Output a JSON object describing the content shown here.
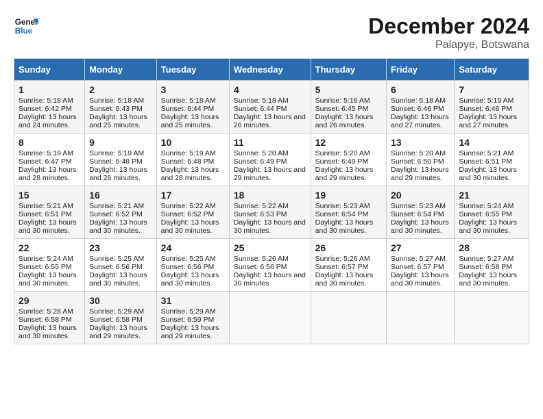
{
  "header": {
    "logo_line1": "General",
    "logo_line2": "Blue",
    "title": "December 2024",
    "subtitle": "Palapye, Botswana"
  },
  "columns": [
    "Sunday",
    "Monday",
    "Tuesday",
    "Wednesday",
    "Thursday",
    "Friday",
    "Saturday"
  ],
  "rows": [
    [
      {
        "day": "1",
        "rise": "Sunrise: 5:18 AM",
        "set": "Sunset: 6:42 PM",
        "daylight": "Daylight: 13 hours and 24 minutes."
      },
      {
        "day": "2",
        "rise": "Sunrise: 5:18 AM",
        "set": "Sunset: 6:43 PM",
        "daylight": "Daylight: 13 hours and 25 minutes."
      },
      {
        "day": "3",
        "rise": "Sunrise: 5:18 AM",
        "set": "Sunset: 6:44 PM",
        "daylight": "Daylight: 13 hours and 25 minutes."
      },
      {
        "day": "4",
        "rise": "Sunrise: 5:18 AM",
        "set": "Sunset: 6:44 PM",
        "daylight": "Daylight: 13 hours and 26 minutes."
      },
      {
        "day": "5",
        "rise": "Sunrise: 5:18 AM",
        "set": "Sunset: 6:45 PM",
        "daylight": "Daylight: 13 hours and 26 minutes."
      },
      {
        "day": "6",
        "rise": "Sunrise: 5:18 AM",
        "set": "Sunset: 6:46 PM",
        "daylight": "Daylight: 13 hours and 27 minutes."
      },
      {
        "day": "7",
        "rise": "Sunrise: 5:19 AM",
        "set": "Sunset: 6:46 PM",
        "daylight": "Daylight: 13 hours and 27 minutes."
      }
    ],
    [
      {
        "day": "8",
        "rise": "Sunrise: 5:19 AM",
        "set": "Sunset: 6:47 PM",
        "daylight": "Daylight: 13 hours and 28 minutes."
      },
      {
        "day": "9",
        "rise": "Sunrise: 5:19 AM",
        "set": "Sunset: 6:48 PM",
        "daylight": "Daylight: 13 hours and 28 minutes."
      },
      {
        "day": "10",
        "rise": "Sunrise: 5:19 AM",
        "set": "Sunset: 6:48 PM",
        "daylight": "Daylight: 13 hours and 28 minutes."
      },
      {
        "day": "11",
        "rise": "Sunrise: 5:20 AM",
        "set": "Sunset: 6:49 PM",
        "daylight": "Daylight: 13 hours and 29 minutes."
      },
      {
        "day": "12",
        "rise": "Sunrise: 5:20 AM",
        "set": "Sunset: 6:49 PM",
        "daylight": "Daylight: 13 hours and 29 minutes."
      },
      {
        "day": "13",
        "rise": "Sunrise: 5:20 AM",
        "set": "Sunset: 6:50 PM",
        "daylight": "Daylight: 13 hours and 29 minutes."
      },
      {
        "day": "14",
        "rise": "Sunrise: 5:21 AM",
        "set": "Sunset: 6:51 PM",
        "daylight": "Daylight: 13 hours and 30 minutes."
      }
    ],
    [
      {
        "day": "15",
        "rise": "Sunrise: 5:21 AM",
        "set": "Sunset: 6:51 PM",
        "daylight": "Daylight: 13 hours and 30 minutes."
      },
      {
        "day": "16",
        "rise": "Sunrise: 5:21 AM",
        "set": "Sunset: 6:52 PM",
        "daylight": "Daylight: 13 hours and 30 minutes."
      },
      {
        "day": "17",
        "rise": "Sunrise: 5:22 AM",
        "set": "Sunset: 6:52 PM",
        "daylight": "Daylight: 13 hours and 30 minutes."
      },
      {
        "day": "18",
        "rise": "Sunrise: 5:22 AM",
        "set": "Sunset: 6:53 PM",
        "daylight": "Daylight: 13 hours and 30 minutes."
      },
      {
        "day": "19",
        "rise": "Sunrise: 5:23 AM",
        "set": "Sunset: 6:54 PM",
        "daylight": "Daylight: 13 hours and 30 minutes."
      },
      {
        "day": "20",
        "rise": "Sunrise: 5:23 AM",
        "set": "Sunset: 6:54 PM",
        "daylight": "Daylight: 13 hours and 30 minutes."
      },
      {
        "day": "21",
        "rise": "Sunrise: 5:24 AM",
        "set": "Sunset: 6:55 PM",
        "daylight": "Daylight: 13 hours and 30 minutes."
      }
    ],
    [
      {
        "day": "22",
        "rise": "Sunrise: 5:24 AM",
        "set": "Sunset: 6:55 PM",
        "daylight": "Daylight: 13 hours and 30 minutes."
      },
      {
        "day": "23",
        "rise": "Sunrise: 5:25 AM",
        "set": "Sunset: 6:56 PM",
        "daylight": "Daylight: 13 hours and 30 minutes."
      },
      {
        "day": "24",
        "rise": "Sunrise: 5:25 AM",
        "set": "Sunset: 6:56 PM",
        "daylight": "Daylight: 13 hours and 30 minutes."
      },
      {
        "day": "25",
        "rise": "Sunrise: 5:26 AM",
        "set": "Sunset: 6:56 PM",
        "daylight": "Daylight: 13 hours and 30 minutes."
      },
      {
        "day": "26",
        "rise": "Sunrise: 5:26 AM",
        "set": "Sunset: 6:57 PM",
        "daylight": "Daylight: 13 hours and 30 minutes."
      },
      {
        "day": "27",
        "rise": "Sunrise: 5:27 AM",
        "set": "Sunset: 6:57 PM",
        "daylight": "Daylight: 13 hours and 30 minutes."
      },
      {
        "day": "28",
        "rise": "Sunrise: 5:27 AM",
        "set": "Sunset: 6:58 PM",
        "daylight": "Daylight: 13 hours and 30 minutes."
      }
    ],
    [
      {
        "day": "29",
        "rise": "Sunrise: 5:28 AM",
        "set": "Sunset: 6:58 PM",
        "daylight": "Daylight: 13 hours and 30 minutes."
      },
      {
        "day": "30",
        "rise": "Sunrise: 5:29 AM",
        "set": "Sunset: 6:58 PM",
        "daylight": "Daylight: 13 hours and 29 minutes."
      },
      {
        "day": "31",
        "rise": "Sunrise: 5:29 AM",
        "set": "Sunset: 6:59 PM",
        "daylight": "Daylight: 13 hours and 29 minutes."
      },
      null,
      null,
      null,
      null
    ]
  ]
}
